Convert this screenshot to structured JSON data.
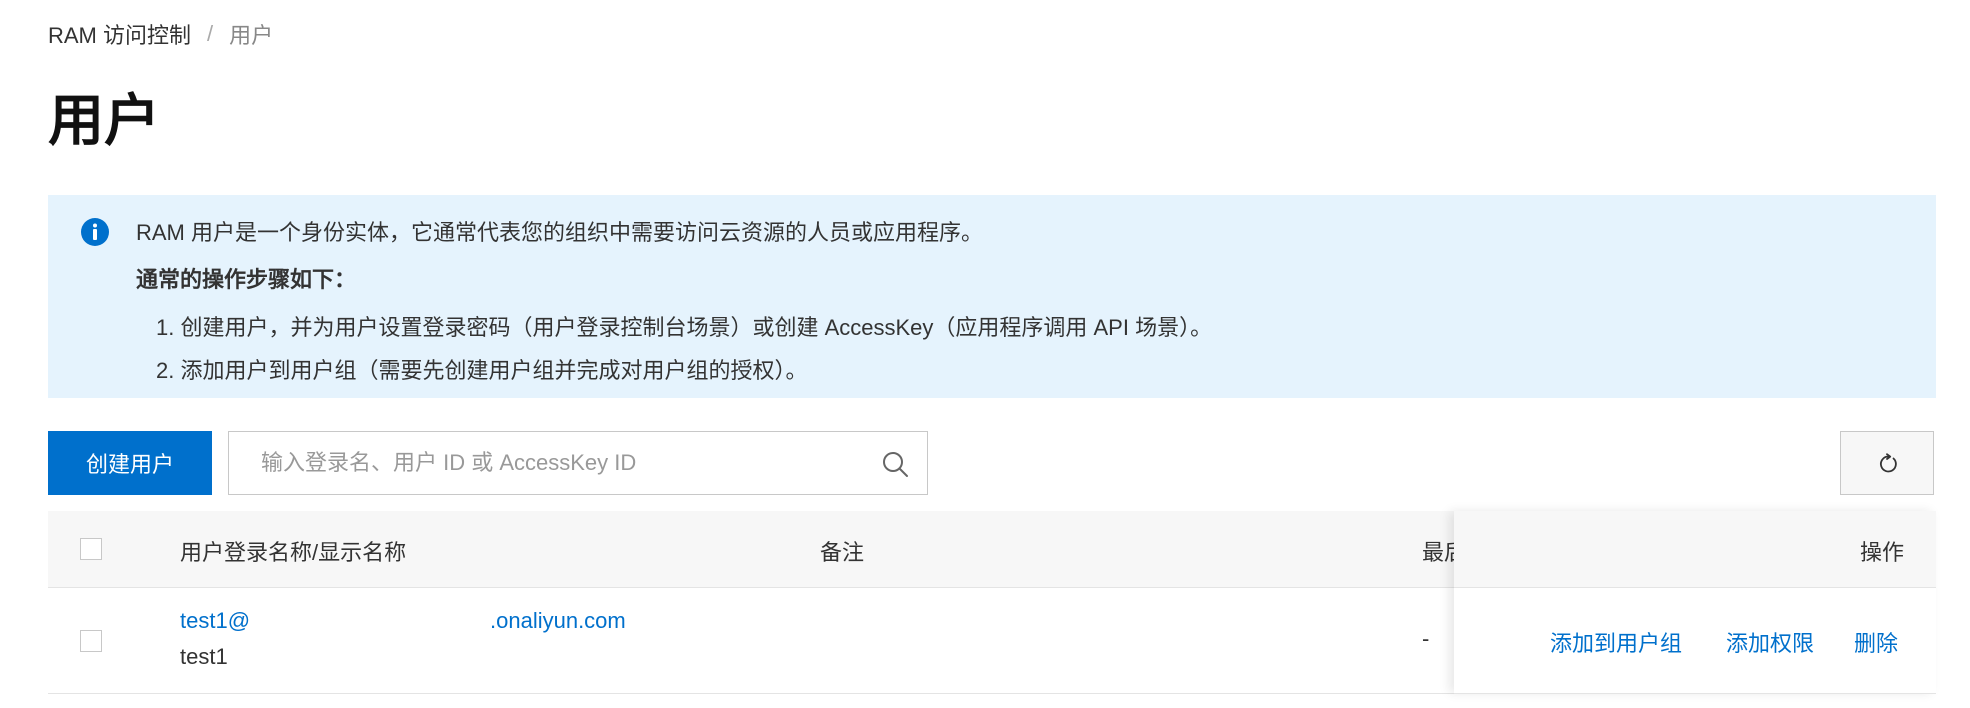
{
  "breadcrumb": {
    "root": "RAM 访问控制",
    "separator": "/",
    "current": "用户"
  },
  "page": {
    "title": "用户"
  },
  "info": {
    "description": "RAM 用户是一个身份实体，它通常代表您的组织中需要访问云资源的人员或应用程序。",
    "steps_title": "通常的操作步骤如下：",
    "steps": [
      "1. 创建用户，并为用户设置登录密码（用户登录控制台场景）或创建 AccessKey（应用程序调用 API 场景）。",
      "2. 添加用户到用户组（需要先创建用户组并完成对用户组的授权）。"
    ]
  },
  "toolbar": {
    "create_label": "创建用户",
    "search_placeholder": "输入登录名、用户 ID 或 AccessKey ID"
  },
  "table": {
    "columns": {
      "name": "用户登录名称/显示名称",
      "remark": "备注",
      "last_login": "最后",
      "actions": "操作"
    },
    "rows": [
      {
        "login_name_prefix": "test1@",
        "login_name_suffix": ".onaliyun.com",
        "display_name": "test1",
        "remark": "",
        "last_login": "-",
        "actions": [
          "添加到用户组",
          "添加权限",
          "删除"
        ]
      }
    ]
  },
  "colors": {
    "primary": "#0070cc",
    "info_bg": "#e5f3fd",
    "header_bg": "#f7f7f7"
  },
  "icons": {
    "info": "info-circle-icon",
    "search": "search-icon",
    "refresh": "refresh-icon"
  }
}
